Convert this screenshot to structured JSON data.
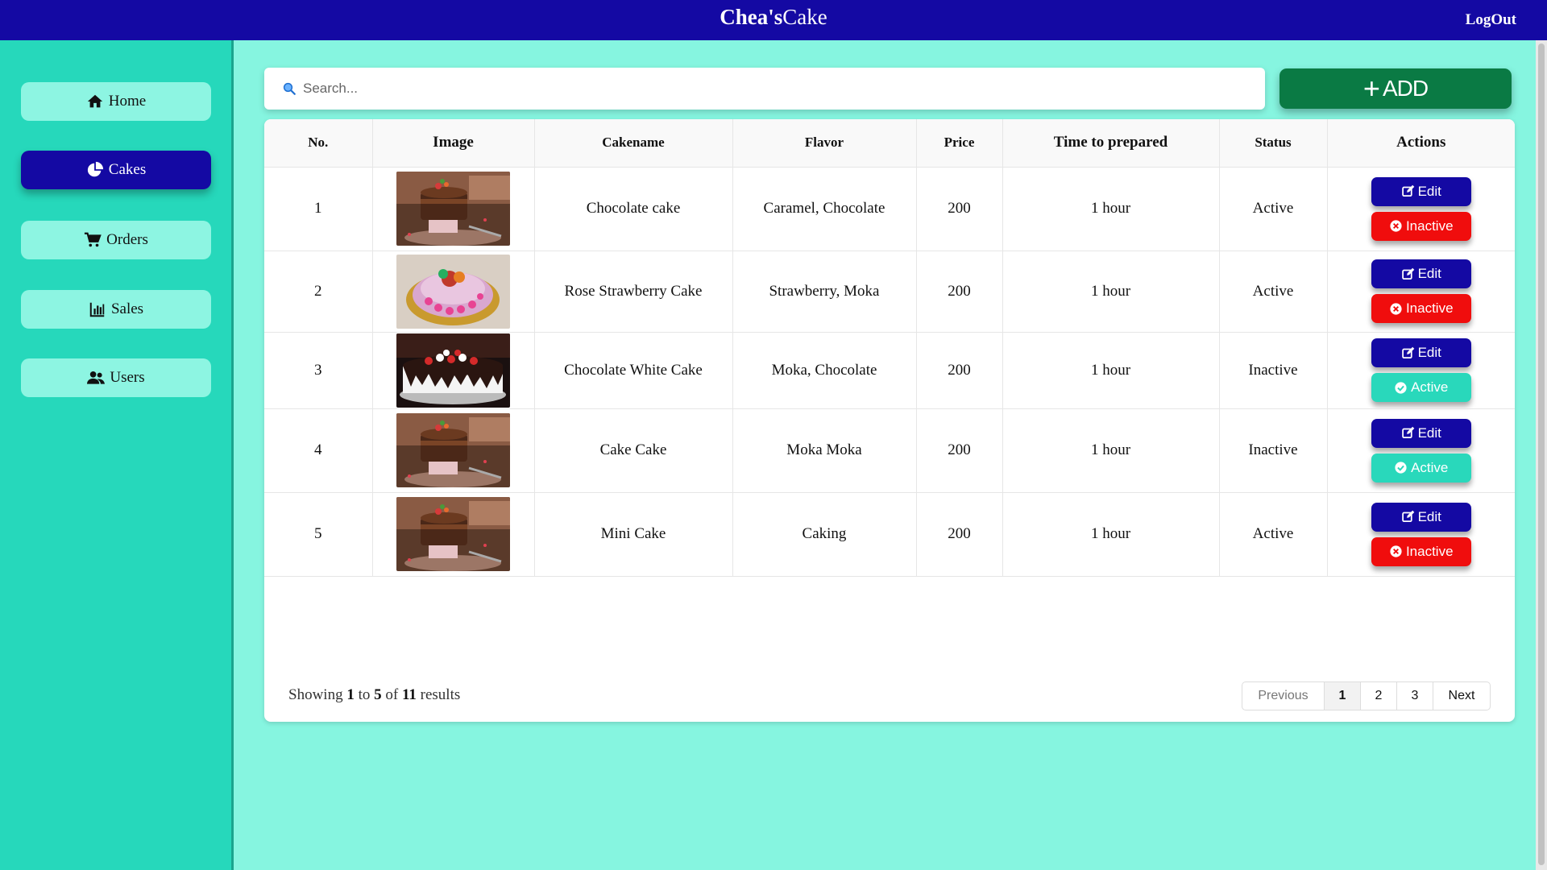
{
  "header": {
    "brand_bold": "Chea's",
    "brand_rest": "Cake",
    "logout_label": "LogOut"
  },
  "sidebar": {
    "items": [
      {
        "label": "Home",
        "icon": "home-icon"
      },
      {
        "label": "Cakes",
        "icon": "pie-chart-icon",
        "active": true
      },
      {
        "label": "Orders",
        "icon": "cart-icon"
      },
      {
        "label": "Sales",
        "icon": "bar-chart-icon"
      },
      {
        "label": "Users",
        "icon": "users-icon"
      }
    ]
  },
  "search": {
    "placeholder": "Search..."
  },
  "add_button": {
    "label": "ADD"
  },
  "table": {
    "headers": [
      "No.",
      "Image",
      "Cakename",
      "Flavor",
      "Price",
      "Time to prepared",
      "Status",
      "Actions"
    ],
    "rows": [
      {
        "no": "1",
        "image": "chocolate-cake-photo",
        "name": "Chocolate cake",
        "flavor": "Caramel, Chocolate",
        "price": "200",
        "time": "1 hour",
        "status": "Active",
        "edit": "Edit",
        "toggle": "Inactive"
      },
      {
        "no": "2",
        "image": "rose-strawberry-cake-photo",
        "name": "Rose Strawberry Cake",
        "flavor": "Strawberry, Moka",
        "price": "200",
        "time": "1 hour",
        "status": "Active",
        "edit": "Edit",
        "toggle": "Inactive"
      },
      {
        "no": "3",
        "image": "chocolate-white-cake-photo",
        "name": "Chocolate White Cake",
        "flavor": "Moka, Chocolate",
        "price": "200",
        "time": "1 hour",
        "status": "Inactive",
        "edit": "Edit",
        "toggle": "Active"
      },
      {
        "no": "4",
        "image": "chocolate-cake-photo",
        "name": "Cake Cake",
        "flavor": "Moka Moka",
        "price": "200",
        "time": "1 hour",
        "status": "Inactive",
        "edit": "Edit",
        "toggle": "Active"
      },
      {
        "no": "5",
        "image": "chocolate-cake-photo",
        "name": "Mini Cake",
        "flavor": "Caking",
        "price": "200",
        "time": "1 hour",
        "status": "Active",
        "edit": "Edit",
        "toggle": "Inactive"
      }
    ]
  },
  "footer": {
    "showing_prefix": "Showing",
    "from": "1",
    "to_word": "to",
    "to": "5",
    "of_word": "of",
    "total": "11",
    "suffix": "results"
  },
  "pagination": {
    "previous": "Previous",
    "pages": [
      "1",
      "2",
      "3"
    ],
    "current": "1",
    "next": "Next"
  },
  "colors": {
    "topbar": "#1409a3",
    "sidebar": "#26d8bb",
    "content_bg": "#86f5e0",
    "add_button": "#0a7a44",
    "inactive_button": "#f00d0d",
    "active_button": "#29d8bb"
  }
}
